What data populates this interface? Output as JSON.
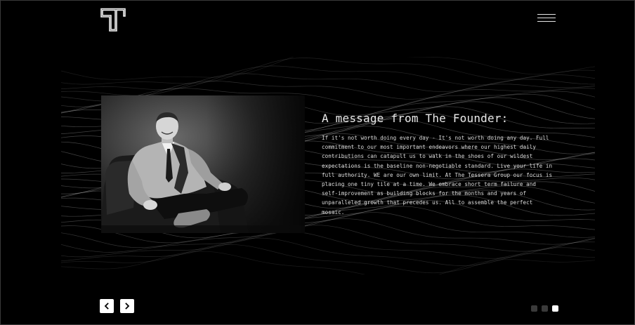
{
  "header": {
    "logo_icon": "tessera-t-logo-icon",
    "menu_icon": "hamburger-menu-icon"
  },
  "hero": {
    "title": "A message from The Founder:",
    "body": "If it's not worth doing every day - It's not worth doing any day. Full commitment to our most important endeavors where our highest daily contributions can catapult us to walk in the shoes of our wildest expectations is the baseline non-negotiable standard. Live your life in full authority. WE are our own limit. At The Tessera Group our focus is placing one tiny tile at a time. We embrace short term failure and self-improvement as building blocks for the months and years of unparalleled growth that precedes us. All to assemble the perfect mosaic."
  },
  "carousel": {
    "prev_icon": "chevron-left-icon",
    "next_icon": "chevron-right-icon",
    "slide_count": 3,
    "active_index": 2
  },
  "colors": {
    "background": "#000000",
    "text": "#eaeaea",
    "button": "#ffffff",
    "dot_inactive": "#3a3a3a",
    "dot_active": "#ffffff"
  }
}
